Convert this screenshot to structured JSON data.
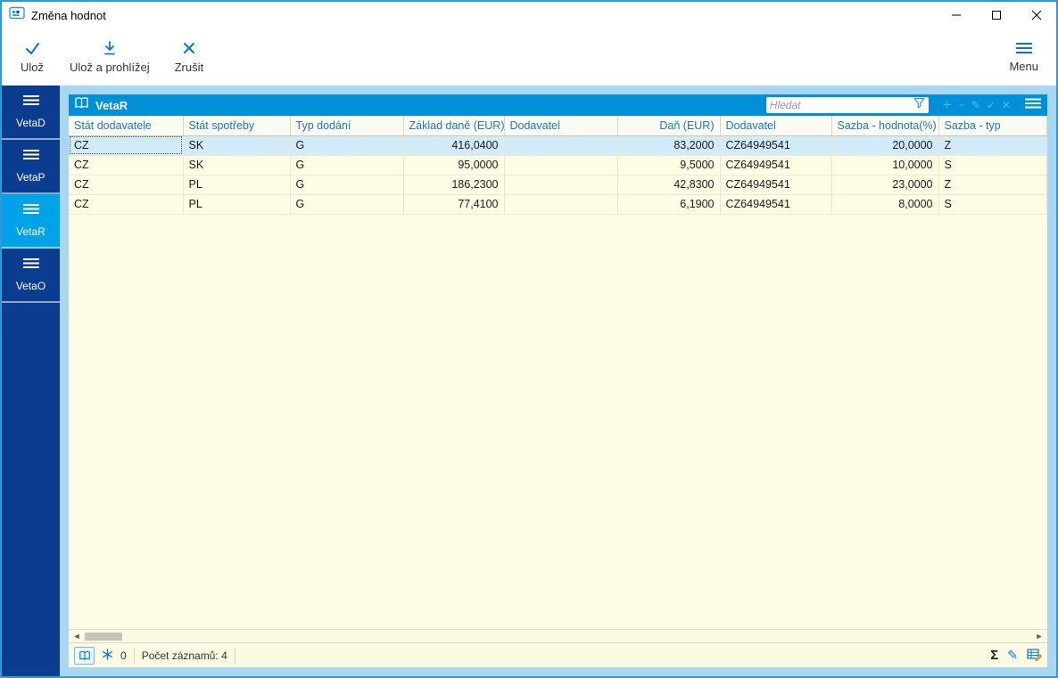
{
  "window": {
    "title": "Změna hodnot"
  },
  "toolbar": {
    "save_label": "Ulož",
    "save_browse_label": "Ulož a prohlížej",
    "cancel_label": "Zrušit",
    "menu_label": "Menu"
  },
  "sidebar": {
    "items": [
      {
        "label": "VetaD",
        "active": false
      },
      {
        "label": "VetaP",
        "active": false
      },
      {
        "label": "VetaR",
        "active": true
      },
      {
        "label": "VetaO",
        "active": false
      }
    ]
  },
  "panel": {
    "title": "VetaR",
    "search": {
      "placeholder": "Hledat",
      "value": ""
    }
  },
  "table": {
    "columns": [
      "Stát dodavatele",
      "Stát spotřeby",
      "Typ dodání",
      "Základ daně (EUR)",
      "Dodavatel",
      "Daň (EUR)",
      "Dodavatel",
      "Sazba - hodnota(%)",
      "Sazba - typ"
    ],
    "rows": [
      [
        "CZ",
        "SK",
        "G",
        "416,0400",
        "",
        "83,2000",
        "CZ64949541",
        "20,0000",
        "Z"
      ],
      [
        "CZ",
        "SK",
        "G",
        "95,0000",
        "",
        "9,5000",
        "CZ64949541",
        "10,0000",
        "S"
      ],
      [
        "CZ",
        "PL",
        "G",
        "186,2300",
        "",
        "42,8300",
        "CZ64949541",
        "23,0000",
        "Z"
      ],
      [
        "CZ",
        "PL",
        "G",
        "77,4100",
        "",
        "6,1900",
        "CZ64949541",
        "8,0000",
        "S"
      ]
    ],
    "selected_row_index": 0
  },
  "statusbar": {
    "pinned_count": "0",
    "record_count": "Počet záznamů: 4"
  },
  "colors": {
    "accent": "#0078d7",
    "sidebar_bg": "#0a3c8f",
    "sidebar_active_bg": "#00a2e8",
    "panel_header_bg": "#0090d8",
    "content_bg": "#a9d7f2",
    "grid_bg": "#fdfce4",
    "selected_row_bg": "#d2ebf8",
    "header_text": "#1b77c8",
    "window_border": "#2e9bd6"
  }
}
